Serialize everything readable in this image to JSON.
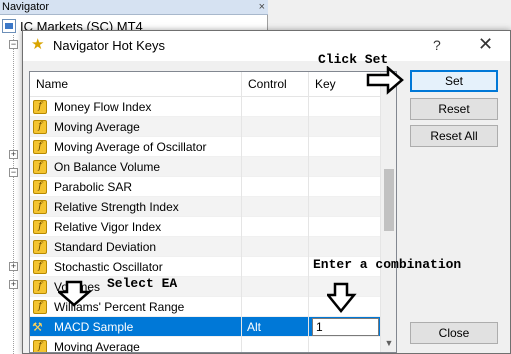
{
  "navigator": {
    "title": "Navigator",
    "close": "×",
    "root": "IC Markets (SC) MT4"
  },
  "dialog": {
    "title": "Navigator Hot Keys",
    "help": "?",
    "close": "✕"
  },
  "table": {
    "columns": {
      "name": "Name",
      "control": "Control",
      "key": "Key"
    },
    "rows": [
      {
        "name": "Money Flow Index",
        "control": "",
        "key": ""
      },
      {
        "name": "Moving Average",
        "control": "",
        "key": ""
      },
      {
        "name": "Moving Average of Oscillator",
        "control": "",
        "key": ""
      },
      {
        "name": "On Balance Volume",
        "control": "",
        "key": ""
      },
      {
        "name": "Parabolic SAR",
        "control": "",
        "key": ""
      },
      {
        "name": "Relative Strength Index",
        "control": "",
        "key": ""
      },
      {
        "name": "Relative Vigor Index",
        "control": "",
        "key": ""
      },
      {
        "name": "Standard Deviation",
        "control": "",
        "key": ""
      },
      {
        "name": "Stochastic Oscillator",
        "control": "",
        "key": ""
      },
      {
        "name": "Volumes",
        "control": "",
        "key": ""
      },
      {
        "name": "Williams' Percent Range",
        "control": "",
        "key": ""
      },
      {
        "name": "MACD Sample",
        "control": "Alt",
        "key": "1"
      },
      {
        "name": "Moving Average",
        "control": "",
        "key": ""
      }
    ],
    "selected_row": "MACD Sample"
  },
  "buttons": {
    "set": "Set",
    "reset": "Reset",
    "reset_all": "Reset All",
    "close": "Close"
  },
  "annotations": {
    "click_set": "Click Set",
    "select_ea": "Select EA",
    "enter_combination": "Enter a combination"
  },
  "icons": {
    "indicator": "function-f-icon",
    "expert": "expert-advisor-icon",
    "dialog": "star-icon"
  },
  "colors": {
    "selection": "#0078d7",
    "indicator_icon": "#f4c430",
    "default_button_border": "#0078d7"
  }
}
